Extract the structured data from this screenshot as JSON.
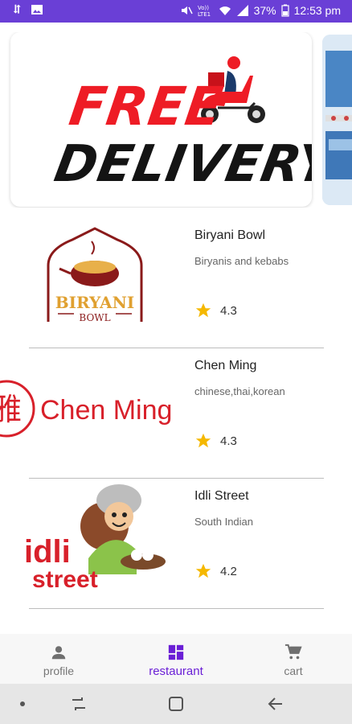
{
  "status_bar": {
    "battery": "37%",
    "time": "12:53 pm"
  },
  "banner": {
    "line1": "FREE",
    "line2": "DELIVERY"
  },
  "restaurants": [
    {
      "name": "Biryani Bowl",
      "category": "Biryanis and kebabs",
      "rating": "4.3",
      "logo_line1": "BIRYANI",
      "logo_line2": "BOWL"
    },
    {
      "name": "Chen Ming",
      "category": "chinese,thai,korean",
      "rating": "4.3",
      "logo_text": "Chen Ming",
      "logo_char": "雅"
    },
    {
      "name": "Idli Street",
      "category": "South Indian",
      "rating": "4.2",
      "logo_line1": "idli",
      "logo_line2": "street"
    }
  ],
  "bottom_nav": {
    "items": [
      {
        "label": "profile",
        "icon": "person-icon"
      },
      {
        "label": "restaurant",
        "icon": "dashboard-icon"
      },
      {
        "label": "cart",
        "icon": "cart-icon"
      }
    ],
    "active": "restaurant"
  },
  "colors": {
    "status_bar": "#6a3fd6",
    "accent": "#6a1fd6",
    "star": "#f5b800",
    "banner_red": "#ee1c25"
  }
}
